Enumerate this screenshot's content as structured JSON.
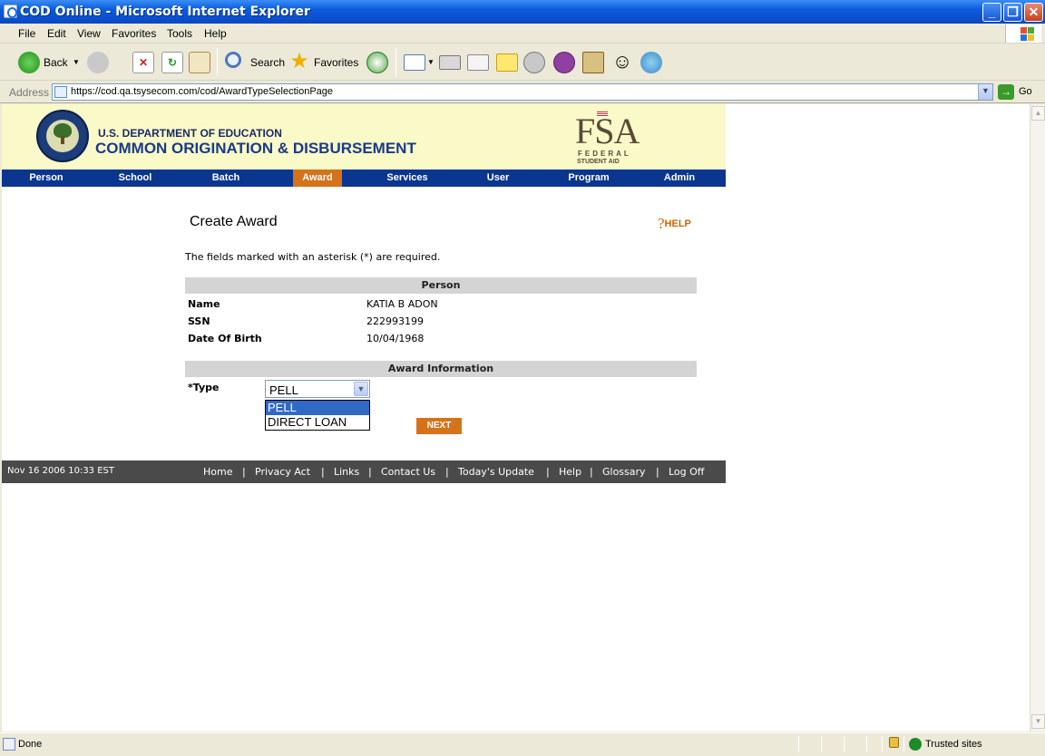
{
  "window": {
    "title": "COD Online - Microsoft Internet Explorer"
  },
  "menu": {
    "items": [
      "File",
      "Edit",
      "View",
      "Favorites",
      "Tools",
      "Help"
    ]
  },
  "toolbar": {
    "back": "Back",
    "search": "Search",
    "favorites": "Favorites"
  },
  "address": {
    "label": "Address",
    "url": "https://cod.qa.tsysecom.com/cod/AwardTypeSelectionPage",
    "go": "Go"
  },
  "banner": {
    "dept": "U.S. DEPARTMENT OF EDUCATION",
    "system": "COMMON ORIGINATION & DISBURSEMENT",
    "fsa_big": "FSA",
    "fsa_line1": "FEDERAL",
    "fsa_line2": "STUDENT AID"
  },
  "nav": {
    "items": [
      "Person",
      "School",
      "Batch",
      "Award",
      "Services",
      "User",
      "Program",
      "Admin"
    ],
    "active": "Award"
  },
  "page": {
    "title": "Create Award",
    "help": "HELP",
    "required_note": "The fields marked with an asterisk (*) are required.",
    "person_header": "Person",
    "person": [
      {
        "label": "Name",
        "value": "KATIA B ADON"
      },
      {
        "label": "SSN",
        "value": "222993199"
      },
      {
        "label": "Date Of Birth",
        "value": "10/04/1968"
      }
    ],
    "award_header": "Award Information",
    "type_label": "*Type",
    "type_selected": "PELL",
    "type_options": [
      "PELL",
      "DIRECT LOAN"
    ],
    "next_button": "NEXT"
  },
  "footer": {
    "timestamp": "Nov 16 2006 10:33 EST",
    "links": [
      "Home",
      "Privacy Act",
      "Links",
      "Contact Us",
      "Today's Update",
      "Help",
      "Glossary",
      "Log Off"
    ]
  },
  "status": {
    "text": "Done",
    "zone": "Trusted sites"
  }
}
